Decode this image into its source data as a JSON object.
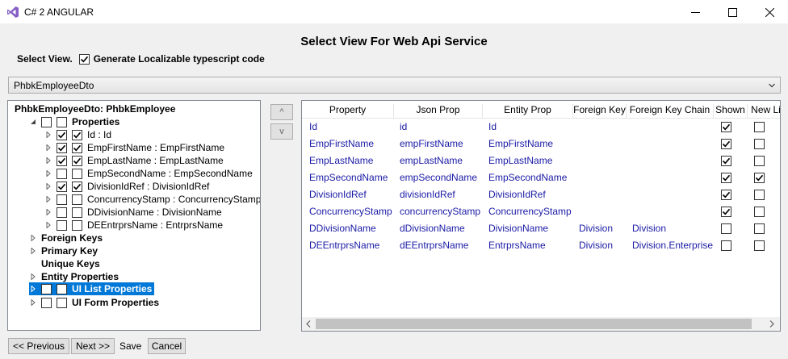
{
  "window": {
    "title": "C# 2 ANGULAR"
  },
  "heading": "Select View For Web Api Service",
  "select_view": {
    "label": "Select View.",
    "localizable_label": "Generate Localizable typescript code",
    "localizable_checked": true
  },
  "combo": {
    "value": "PhbkEmployeeDto"
  },
  "tree": {
    "root": "PhbkEmployeeDto: PhbkEmployee",
    "properties_label": "Properties",
    "properties": [
      {
        "label": "Id : Id",
        "checked": true,
        "checked2": true
      },
      {
        "label": "EmpFirstName : EmpFirstName",
        "checked": true,
        "checked2": true
      },
      {
        "label": "EmpLastName : EmpLastName",
        "checked": true,
        "checked2": true
      },
      {
        "label": "EmpSecondName : EmpSecondName",
        "checked": false,
        "checked2": false
      },
      {
        "label": "DivisionIdRef : DivisionIdRef",
        "checked": true,
        "checked2": true
      },
      {
        "label": "ConcurrencyStamp : ConcurrencyStamp",
        "checked": false,
        "checked2": false
      },
      {
        "label": "DDivisionName : DivisionName",
        "checked": false,
        "checked2": false
      },
      {
        "label": "DEEntrprsName : EntrprsName",
        "checked": false,
        "checked2": false
      }
    ],
    "foreign_keys": "Foreign Keys",
    "primary_key": "Primary Key",
    "unique_keys": "Unique Keys",
    "entity_properties": "Entity Properties",
    "ui_list_properties": "UI List Properties",
    "ui_form_properties": "UI Form Properties"
  },
  "updown": {
    "up": "^",
    "down": "v"
  },
  "grid": {
    "columns": [
      "Property",
      "Json Prop",
      "Entity Prop",
      "Foreign Key",
      "Foreign Key Chain",
      "Shown",
      "New Lir"
    ],
    "rows": [
      {
        "property": "Id",
        "json": "id",
        "entity": "Id",
        "fk": "",
        "fkchain": "",
        "shown": true,
        "newline": false
      },
      {
        "property": "EmpFirstName",
        "json": "empFirstName",
        "entity": "EmpFirstName",
        "fk": "",
        "fkchain": "",
        "shown": true,
        "newline": false
      },
      {
        "property": "EmpLastName",
        "json": "empLastName",
        "entity": "EmpLastName",
        "fk": "",
        "fkchain": "",
        "shown": true,
        "newline": false
      },
      {
        "property": "EmpSecondName",
        "json": "empSecondName",
        "entity": "EmpSecondName",
        "fk": "",
        "fkchain": "",
        "shown": true,
        "newline": true
      },
      {
        "property": "DivisionIdRef",
        "json": "divisionIdRef",
        "entity": "DivisionIdRef",
        "fk": "",
        "fkchain": "",
        "shown": true,
        "newline": false
      },
      {
        "property": "ConcurrencyStamp",
        "json": "concurrencyStamp",
        "entity": "ConcurrencyStamp",
        "fk": "",
        "fkchain": "",
        "shown": true,
        "newline": false
      },
      {
        "property": "DDivisionName",
        "json": "dDivisionName",
        "entity": "DivisionName",
        "fk": "Division",
        "fkchain": "Division",
        "shown": false,
        "newline": false
      },
      {
        "property": "DEEntrprsName",
        "json": "dEEntrprsName",
        "entity": "EntrprsName",
        "fk": "Division",
        "fkchain": "Division.Enterprise",
        "shown": false,
        "newline": false
      }
    ]
  },
  "buttons": {
    "previous": "<< Previous",
    "next": "Next >>",
    "save": "Save",
    "cancel": "Cancel"
  },
  "colors": {
    "accent": "#0078d7",
    "value_text": "#1a1aa6",
    "vs_purple": "#865fc5"
  }
}
